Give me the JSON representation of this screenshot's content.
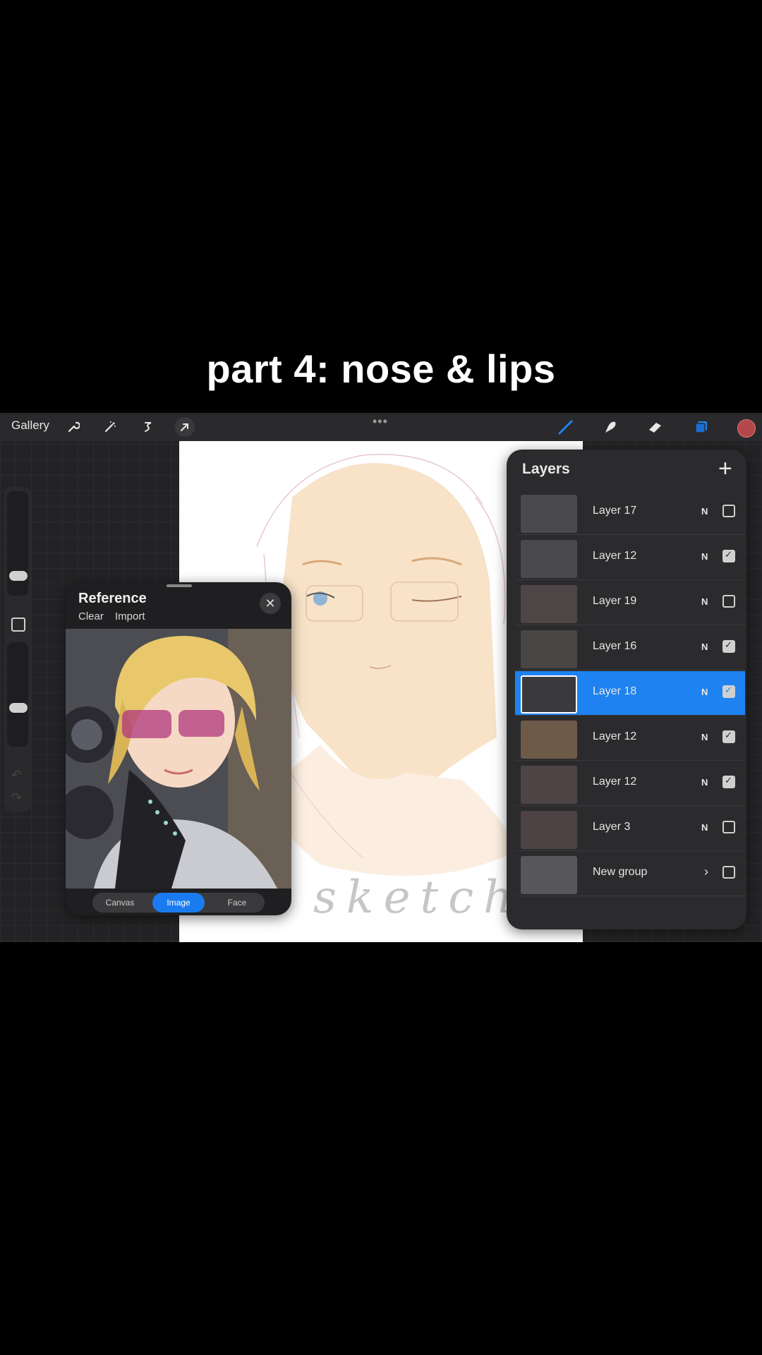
{
  "caption": "part 4: nose & lips",
  "toolbar": {
    "gallery_label": "Gallery",
    "more_dots": "•••",
    "current_color": "#b3474c"
  },
  "canvas": {
    "watermark_text": "sketchgroup"
  },
  "reference": {
    "title": "Reference",
    "clear_label": "Clear",
    "import_label": "Import",
    "close_glyph": "✕",
    "tabs": [
      {
        "label": "Canvas",
        "active": false
      },
      {
        "label": "Image",
        "active": true
      },
      {
        "label": "Face",
        "active": false
      }
    ]
  },
  "layers": {
    "title": "Layers",
    "add_glyph": "+",
    "items": [
      {
        "name": "Layer 17",
        "mode": "N",
        "visible": false,
        "active": false
      },
      {
        "name": "Layer 12",
        "mode": "N",
        "visible": true,
        "active": false
      },
      {
        "name": "Layer 19",
        "mode": "N",
        "visible": false,
        "active": false
      },
      {
        "name": "Layer 16",
        "mode": "N",
        "visible": true,
        "active": false
      },
      {
        "name": "Layer 18",
        "mode": "N",
        "visible": true,
        "active": true
      },
      {
        "name": "Layer 12",
        "mode": "N",
        "visible": true,
        "active": false
      },
      {
        "name": "Layer 12",
        "mode": "N",
        "visible": true,
        "active": false
      },
      {
        "name": "Layer 3",
        "mode": "N",
        "visible": false,
        "active": false
      },
      {
        "name": "New group",
        "mode": "›",
        "visible": false,
        "active": false,
        "group": true
      }
    ]
  }
}
